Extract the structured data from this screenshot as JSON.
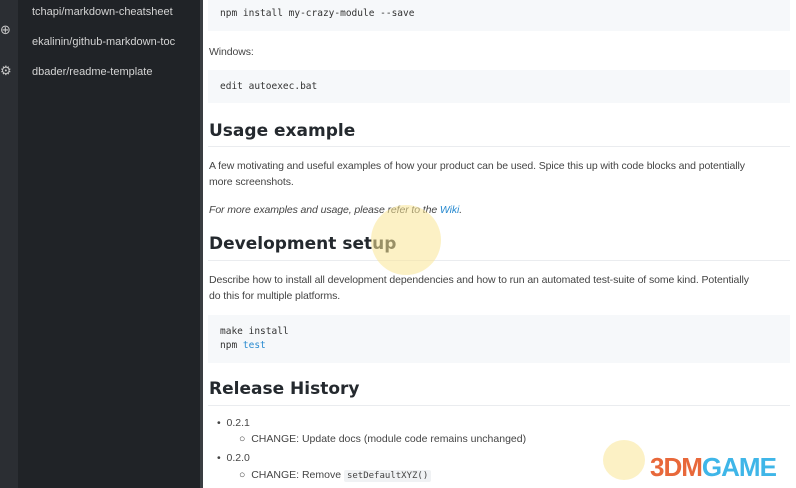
{
  "activity_bar": {
    "icons": [
      "plus-circle-icon",
      "gear-icon"
    ]
  },
  "sidebar": {
    "items": [
      {
        "label": "tchapi/markdown-cheatsheet"
      },
      {
        "label": "ekalinin/github-markdown-toc"
      },
      {
        "label": "dbader/readme-template"
      }
    ]
  },
  "content": {
    "code1": "npm install my-crazy-module --save",
    "windows_label": "Windows:",
    "code2": "edit autoexec.bat",
    "usage_heading": "Usage example",
    "usage_para_1": "A few motivating and useful examples of how your product can be used. Spice this up with code blocks and potentially",
    "usage_para_2": "more screenshots.",
    "usage_more": "For more examples and usage, please refer to the ",
    "wiki_link": "Wiki",
    "usage_more_end": ".",
    "dev_heading": "Development setup",
    "dev_para_1": "Describe how to install all development dependencies and how to run an automated test-suite of some kind. Potentially",
    "dev_para_2": "do this for multiple platforms.",
    "code3_line1": "make install",
    "code3_line2_cmd": "npm ",
    "code3_line2_arg": "test",
    "release_heading": "Release History",
    "releases": [
      {
        "version": "0.2.1",
        "change": "CHANGE: Update docs (module code remains unchanged)"
      },
      {
        "version": "0.2.0",
        "change_prefix": "CHANGE: Remove ",
        "change_code": "setDefaultXYZ()"
      }
    ]
  },
  "watermark": {
    "text_a": "3DM",
    "text_b": "GAME",
    "color_a": "#e8683a",
    "color_b": "#3fb6e8"
  }
}
